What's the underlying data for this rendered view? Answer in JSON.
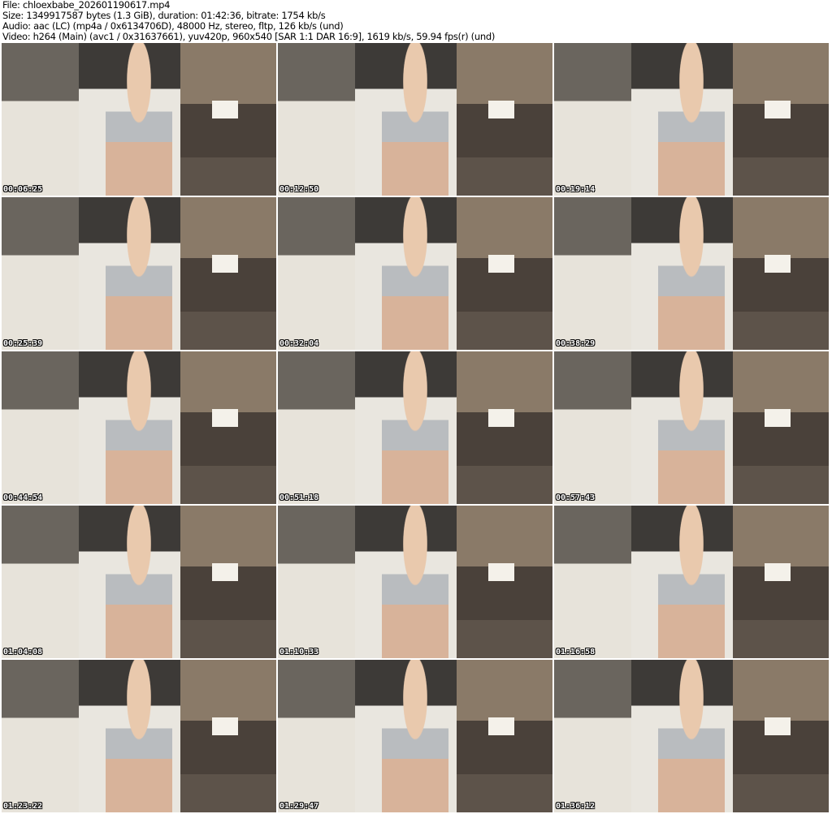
{
  "header": {
    "file": "File: chloexbabe_202601190617.mp4",
    "size": "Size: 1349917587 bytes (1.3 GiB), duration: 01:42:36, bitrate: 1754 kb/s",
    "audio": "Audio: aac (LC) (mp4a / 0x6134706D), 48000 Hz, stereo, fltp, 126 kb/s (und)",
    "video": "Video: h264 (Main) (avc1 / 0x31637661), yuv420p, 960x540 [SAR 1:1 DAR 16:9], 1619 kb/s, 59.94 fps(r) (und)"
  },
  "thumbnails": [
    {
      "timestamp": "00:06:25"
    },
    {
      "timestamp": "00:12:50"
    },
    {
      "timestamp": "00:19:14"
    },
    {
      "timestamp": "00:25:39"
    },
    {
      "timestamp": "00:32:04"
    },
    {
      "timestamp": "00:38:29"
    },
    {
      "timestamp": "00:44:54"
    },
    {
      "timestamp": "00:51:18"
    },
    {
      "timestamp": "00:57:43"
    },
    {
      "timestamp": "01:04:08"
    },
    {
      "timestamp": "01:10:33"
    },
    {
      "timestamp": "01:16:58"
    },
    {
      "timestamp": "01:23:22"
    },
    {
      "timestamp": "01:29:47"
    },
    {
      "timestamp": "01:36:12"
    }
  ]
}
